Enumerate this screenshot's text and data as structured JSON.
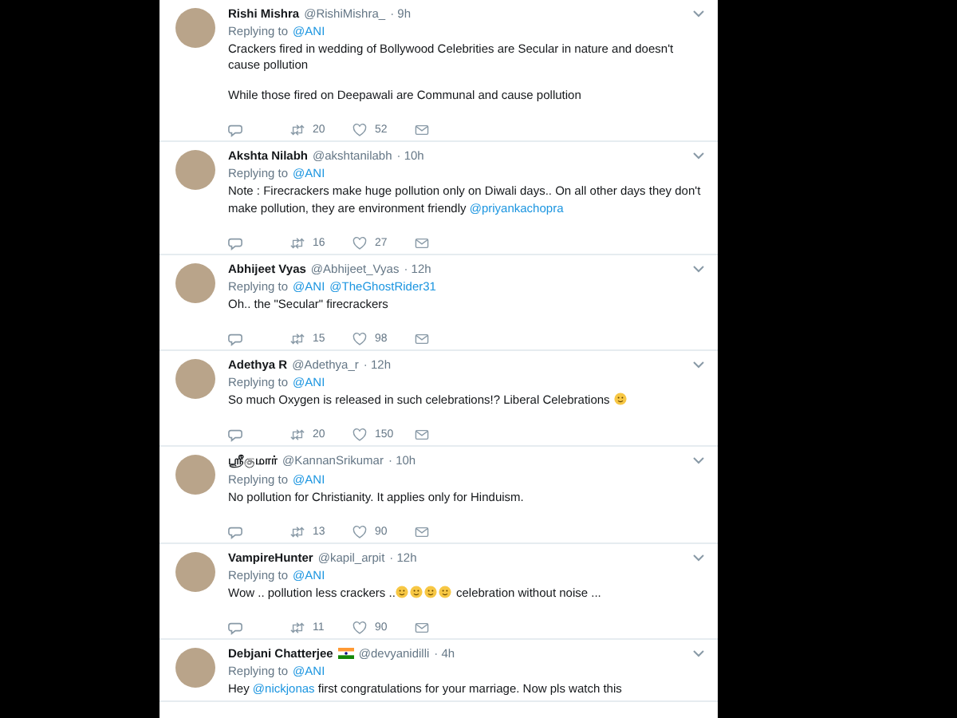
{
  "replies": [
    {
      "name": "Rishi Mishra",
      "handle": "@RishiMishra_",
      "time": "· 9h",
      "flag": false,
      "replying_label": "Replying to",
      "replying_to": [
        "@ANI"
      ],
      "paragraphs": [
        [
          {
            "kind": "text",
            "text": "Crackers fired in wedding of Bollywood Celebrities are Secular in nature and doesn't cause pollution"
          }
        ],
        [
          {
            "kind": "text",
            "text": "While those fired on Deepawali are Communal and cause pollution"
          }
        ]
      ],
      "retweets": "20",
      "likes": "52"
    },
    {
      "name": "Akshta Nilabh",
      "handle": "@akshtanilabh",
      "time": "· 10h",
      "flag": false,
      "replying_label": "Replying to",
      "replying_to": [
        "@ANI"
      ],
      "paragraphs": [
        [
          {
            "kind": "text",
            "text": "Note : Firecrackers make huge pollution only on Diwali days.. On all other days they don't make pollution, they are environment friendly "
          },
          {
            "kind": "mention",
            "text": "@priyankachopra"
          }
        ]
      ],
      "retweets": "16",
      "likes": "27"
    },
    {
      "name": "Abhijeet Vyas",
      "handle": "@Abhijeet_Vyas",
      "time": "· 12h",
      "flag": false,
      "replying_label": "Replying to",
      "replying_to": [
        "@ANI",
        "@TheGhostRider31"
      ],
      "paragraphs": [
        [
          {
            "kind": "text",
            "text": "Oh.. the \"Secular\" firecrackers"
          }
        ]
      ],
      "retweets": "15",
      "likes": "98"
    },
    {
      "name": "Adethya R",
      "handle": "@Adethya_r",
      "time": "· 12h",
      "flag": false,
      "replying_label": "Replying to",
      "replying_to": [
        "@ANI"
      ],
      "paragraphs": [
        [
          {
            "kind": "text",
            "text": "So much Oxygen is released in such celebrations!? Liberal Celebrations "
          },
          {
            "kind": "emoji"
          }
        ]
      ],
      "retweets": "20",
      "likes": "150"
    },
    {
      "name": "ஸ்ரீகுமார்",
      "handle": "@KannanSrikumar",
      "time": "· 10h",
      "flag": false,
      "replying_label": "Replying to",
      "replying_to": [
        "@ANI"
      ],
      "paragraphs": [
        [
          {
            "kind": "text",
            "text": "No pollution for Christianity. It applies only for Hinduism."
          }
        ]
      ],
      "retweets": "13",
      "likes": "90"
    },
    {
      "name": "VampireHunter",
      "handle": "@kapil_arpit",
      "time": "· 12h",
      "flag": false,
      "replying_label": "Replying to",
      "replying_to": [
        "@ANI"
      ],
      "paragraphs": [
        [
          {
            "kind": "text",
            "text": "Wow .. pollution less crackers .."
          },
          {
            "kind": "emoji"
          },
          {
            "kind": "emoji"
          },
          {
            "kind": "emoji"
          },
          {
            "kind": "emoji"
          },
          {
            "kind": "text",
            "text": " celebration without noise ..."
          }
        ]
      ],
      "retweets": "11",
      "likes": "90"
    },
    {
      "name": "Debjani Chatterjee",
      "handle": "@devyanidilli",
      "time": "· 4h",
      "flag": true,
      "replying_label": "Replying to",
      "replying_to": [
        "@ANI"
      ],
      "paragraphs": [
        [
          {
            "kind": "text",
            "text": "Hey "
          },
          {
            "kind": "mention",
            "text": "@nickjonas"
          },
          {
            "kind": "text",
            "text": " first congratulations for your marriage. Now pls watch this"
          }
        ]
      ]
    }
  ]
}
